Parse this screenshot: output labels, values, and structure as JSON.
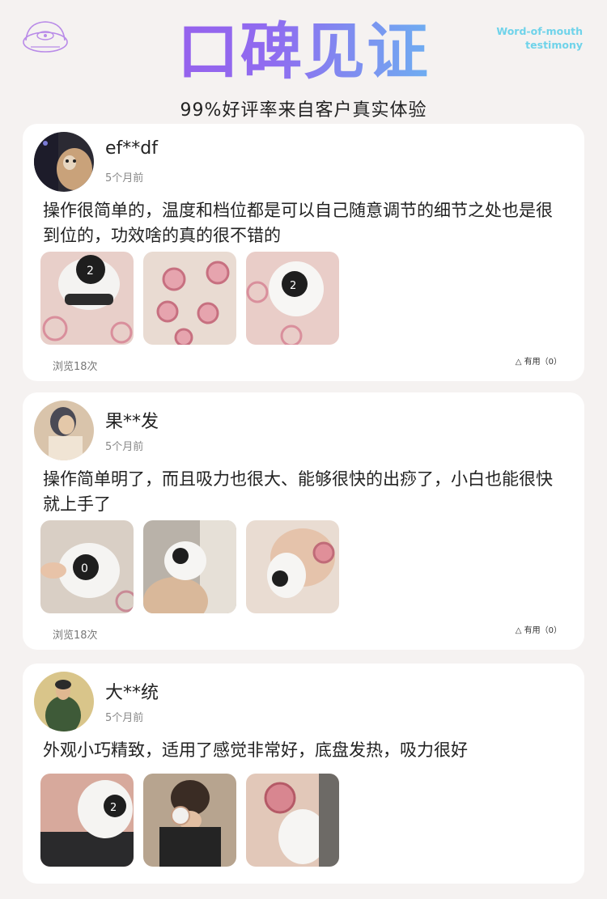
{
  "header": {
    "title": "口碑见证",
    "subtitle": "99%好评率来自客户真实体验",
    "tagline_line1": "Word-of-mouth",
    "tagline_line2": "testimony",
    "gradient_colors": [
      "#a34fe6",
      "#59d6ee"
    ]
  },
  "reviews": [
    {
      "username": "ef**df",
      "time": "5个月前",
      "comment": "操作很简单的，温度和档位都是可以自己随意调节的细节之处也是很到位的，功效啥的真的很不错的",
      "views": "浏览18次",
      "helpful": "△ 有用（0）",
      "photos": [
        "device-on-skin",
        "cupping-marks-back",
        "device-on-back"
      ]
    },
    {
      "username": "果**发",
      "time": "5个月前",
      "comment": "操作简单明了，而且吸力也很大、能够很快的出痧了，小白也能很快就上手了",
      "views": "浏览18次",
      "helpful": "△ 有用（0）",
      "photos": [
        "device-in-hand",
        "device-on-shoulder",
        "device-on-arm"
      ]
    },
    {
      "username": "大**统",
      "time": "5个月前",
      "comment": "外观小巧精致，适用了感觉非常好，底盘发热，吸力很好",
      "photos": [
        "device-on-waist",
        "device-on-neck",
        "device-on-shoulder-mark"
      ]
    }
  ]
}
